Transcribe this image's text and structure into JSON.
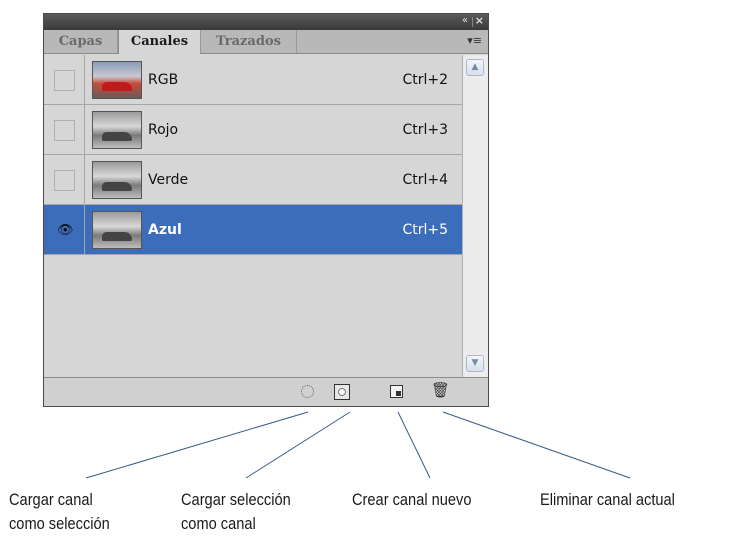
{
  "tabs": [
    "Capas",
    "Canales",
    "Trazados"
  ],
  "active_tab": "Canales",
  "titlebar": {
    "collapse_icon": "«",
    "close_icon": "×"
  },
  "panel_menu_icon": "▾≡",
  "channels": [
    {
      "name": "RGB",
      "shortcut": "Ctrl+2",
      "visible": false,
      "selected": false,
      "thumb": "color"
    },
    {
      "name": "Rojo",
      "shortcut": "Ctrl+3",
      "visible": false,
      "selected": false,
      "thumb": "gray"
    },
    {
      "name": "Verde",
      "shortcut": "Ctrl+4",
      "visible": false,
      "selected": false,
      "thumb": "gray"
    },
    {
      "name": "Azul",
      "shortcut": "Ctrl+5",
      "visible": true,
      "selected": true,
      "thumb": "gray"
    }
  ],
  "eye_icon": "👁",
  "scrollbar": {
    "up": "▲",
    "down": "▼"
  },
  "trash_icon": "🗑",
  "callouts": [
    {
      "line1": "Cargar canal",
      "line2": "como selección"
    },
    {
      "line1": "Cargar selección",
      "line2": "como canal"
    },
    {
      "line1": "Crear canal nuevo",
      "line2": ""
    },
    {
      "line1": "Eliminar canal actual",
      "line2": ""
    }
  ],
  "colors": {
    "selection": "#3b6dbb",
    "panel": "#d6d6d6",
    "titlebar": "#3a3a3a"
  }
}
